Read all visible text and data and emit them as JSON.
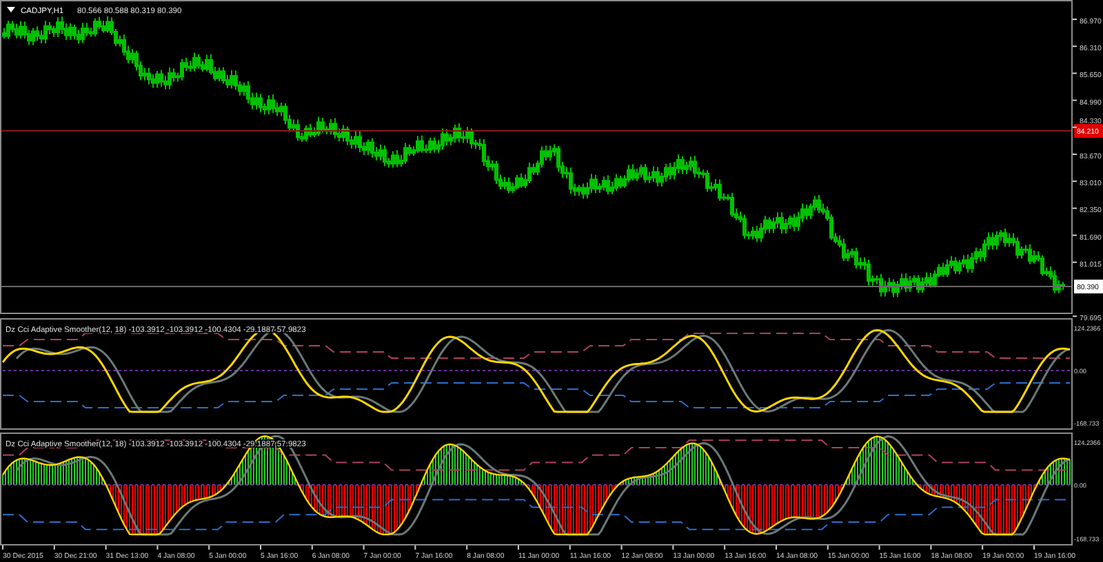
{
  "main_pane": {
    "symbol": "CADJPY,H1",
    "ohlc": "80.566 80.588 80.319 80.390",
    "price_axis": [
      "86.970",
      "86.310",
      "85.650",
      "84.990",
      "84.330",
      "83.670",
      "83.010",
      "82.350",
      "81.690",
      "81.015",
      "79.695"
    ],
    "marker_lines": [
      {
        "label": "84.210",
        "kind": "alert"
      },
      {
        "label": "80.390",
        "kind": "bid"
      }
    ]
  },
  "indicator_panes": [
    {
      "kind": "line",
      "title": "Dz Cci Adaptive Smoother(12, 18) -103.3912 -103.3912 -100.4304 -29.1887 57.9823",
      "axis": [
        "124.2366",
        "0.00",
        "-168.733"
      ]
    },
    {
      "kind": "histogram",
      "title": "Dz Cci Adaptive Smoother(12, 18) -103.3912 -103.3912 -100.4304 -29.1887 57.9823",
      "axis": [
        "124.2366",
        "0.00",
        "-168.733"
      ]
    }
  ],
  "time_axis": [
    "30 Dec 2015",
    "30 Dec 21:00",
    "31 Dec 13:00",
    "4 Jan 08:00",
    "5 Jan 00:00",
    "5 Jan 16:00",
    "6 Jan 08:00",
    "7 Jan 00:00",
    "7 Jan 16:00",
    "8 Jan 08:00",
    "11 Jan 00:00",
    "11 Jan 16:00",
    "12 Jan 08:00",
    "13 Jan 00:00",
    "13 Jan 16:00",
    "14 Jan 08:00",
    "15 Jan 00:00",
    "15 Jan 16:00",
    "18 Jan 08:00",
    "19 Jan 00:00",
    "19 Jan 16:00"
  ]
}
